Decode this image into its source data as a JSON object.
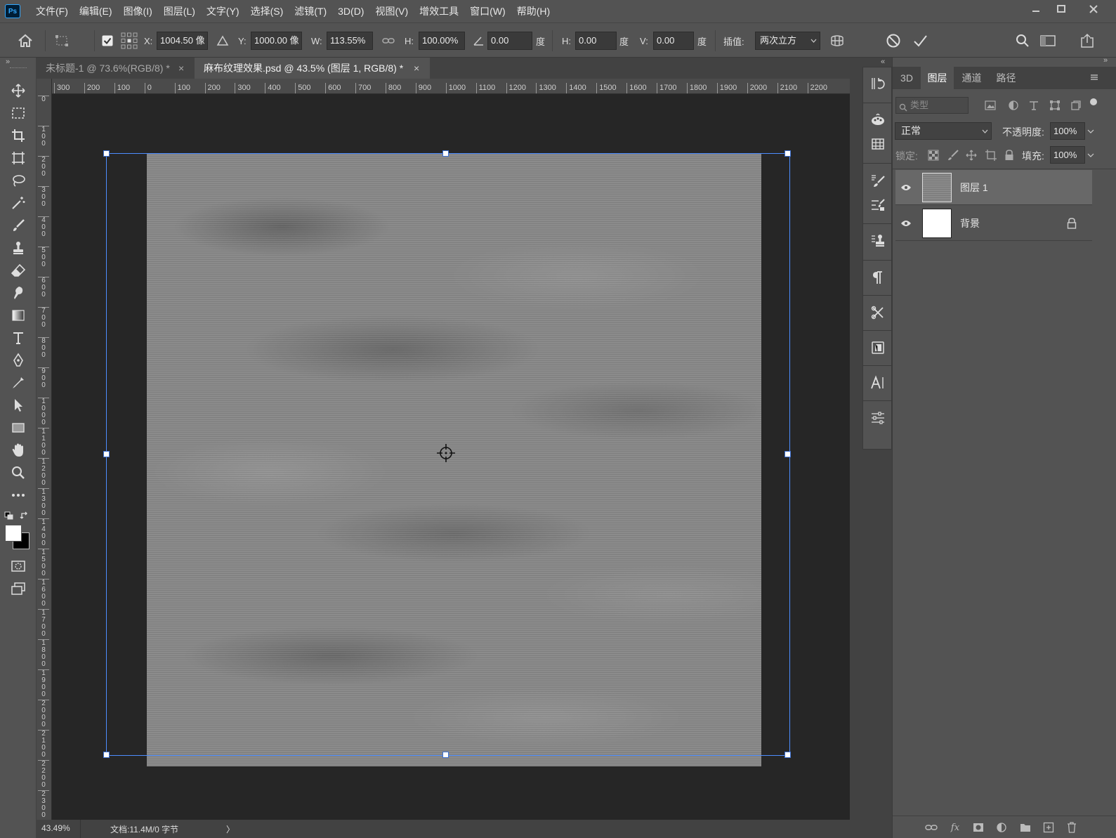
{
  "menubar": {
    "logo": "Ps",
    "items": [
      "文件(F)",
      "编辑(E)",
      "图像(I)",
      "图层(L)",
      "文字(Y)",
      "选择(S)",
      "滤镜(T)",
      "3D(D)",
      "视图(V)",
      "增效工具",
      "窗口(W)",
      "帮助(H)"
    ],
    "window_controls": [
      "minimize-icon",
      "restore-icon",
      "close-icon"
    ]
  },
  "options": {
    "x_label": "X:",
    "x_value": "1004.50 像",
    "y_label": "Y:",
    "y_value": "1000.00 像",
    "w_label": "W:",
    "w_value": "113.55%",
    "h_label": "H:",
    "h_value": "100.00%",
    "angle_value": "0.00",
    "angle_unit": "度",
    "skew_h_label": "H:",
    "skew_h_value": "0.00",
    "skew_h_unit": "度",
    "skew_v_label": "V:",
    "skew_v_value": "0.00",
    "skew_v_unit": "度",
    "interp_label": "插值:",
    "interp_value": "两次立方",
    "commit_checked": true
  },
  "tabs": [
    {
      "label": "未标题-1 @ 73.6%(RGB/8) *",
      "active": false
    },
    {
      "label": "麻布纹理效果.psd @ 43.5% (图层 1, RGB/8) *",
      "active": true
    }
  ],
  "ruler": {
    "h_ticks": [
      "300",
      "200",
      "100",
      "0",
      "100",
      "200",
      "300",
      "400",
      "500",
      "600",
      "700",
      "800",
      "900",
      "1000",
      "1100",
      "1200",
      "1300",
      "1400",
      "1500",
      "1600",
      "1700",
      "1800",
      "1900",
      "2000",
      "2100",
      "2200"
    ],
    "v_ticks": [
      "0",
      "100",
      "200",
      "300",
      "400",
      "500",
      "600",
      "700",
      "800",
      "900",
      "1000",
      "1100",
      "1200",
      "1300",
      "1400",
      "1500",
      "1600",
      "1700",
      "1800",
      "1900",
      "2000",
      "2100",
      "2200",
      "2300",
      "2400"
    ]
  },
  "status": {
    "zoom": "43.49%",
    "doc_info": "文档:11.4M/0 字节",
    "arrow": "〉"
  },
  "panel": {
    "tabs": [
      "3D",
      "图层",
      "通道",
      "路径"
    ],
    "active_tab": "图层",
    "filter_placeholder": "类型",
    "blend_mode": "正常",
    "opacity_label": "不透明度:",
    "opacity_value": "100%",
    "lock_label": "锁定:",
    "fill_label": "填充:",
    "fill_value": "100%",
    "layers": [
      {
        "name": "图层 1",
        "visible": true,
        "selected": true,
        "locked": false
      },
      {
        "name": "背景",
        "visible": true,
        "selected": false,
        "locked": true
      }
    ]
  },
  "colors": {
    "ui_bg": "#535353",
    "canvas_bg": "#262626",
    "selection": "#4d8dff",
    "foreground": "#ffffff",
    "background": "#000000"
  }
}
